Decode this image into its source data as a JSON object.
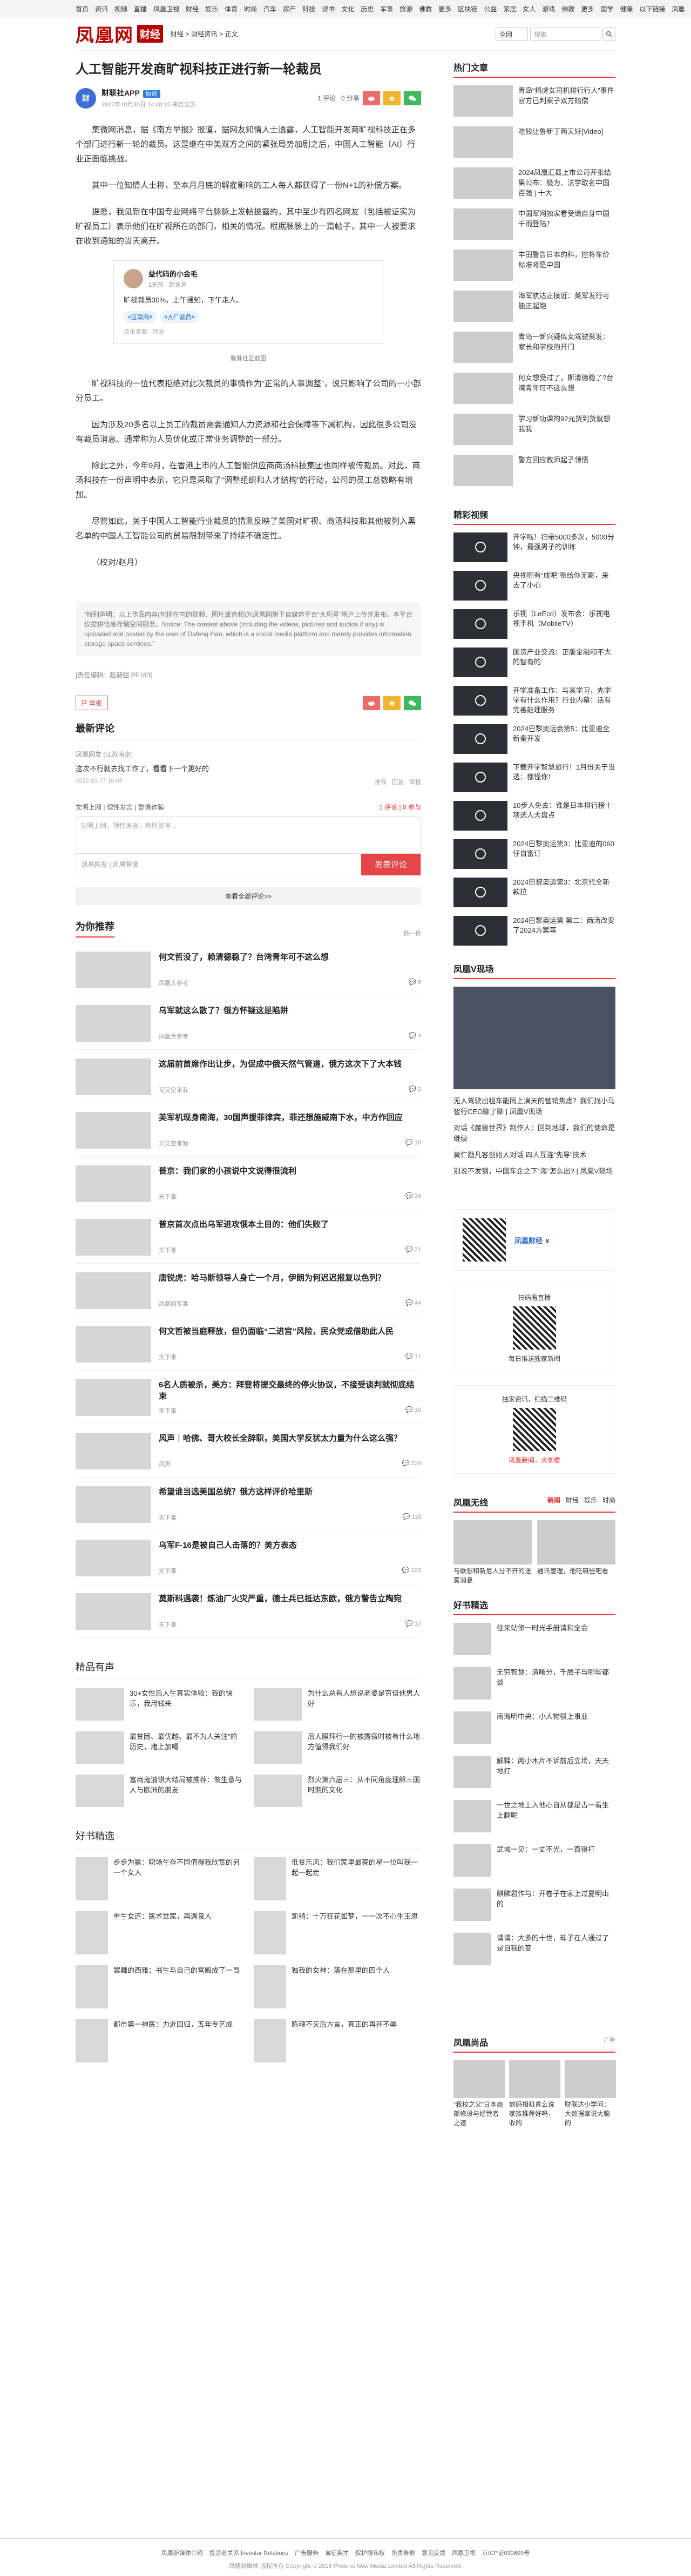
{
  "topnav": [
    "首页",
    "资讯",
    "视频",
    "直播",
    "凤凰卫视",
    "财经",
    "娱乐",
    "体育",
    "时尚",
    "汽车",
    "房产",
    "科技",
    "读书",
    "文化",
    "历史",
    "军事",
    "旅游",
    "佛教",
    "更多",
    "区块链",
    "公益",
    "家居",
    "女人",
    "游戏",
    "佛教",
    "更多",
    "国学",
    "健康",
    "以下链接",
    "凤凰",
    "登录",
    "注册"
  ],
  "header": {
    "logo_text": "凤凰网",
    "logo_badge": "财经",
    "crumbs": [
      "财经",
      "财经资讯",
      "正文"
    ],
    "search_select": "全网",
    "search_placeholder": "搜索"
  },
  "article": {
    "title": "人工智能开发商旷视科技正进行新一轮裁员",
    "source_name": "财联社APP",
    "source_tag": "原创",
    "time": "2022年10月30日 14:48:15 来自江苏",
    "stats": {
      "comments": "1 评论",
      "shares": "0 分享"
    },
    "paragraphs": [
      "集微网消息，据《南方早报》报道，据网友知情人士透露，人工智能开发商旷视科技正在多个部门进行新一轮的裁员。这是继在中美双方之间的紧张局势加剧之后，中国人工智能（AI）行业正面临挑战。",
      "其中一位知情人士称，至本月月底的解雇影响的工人每人都获得了一份N+1的补偿方案。",
      "据悉，我见新在中国专业网络平台脉脉上发帖披露的，其中至少有四名网友（包括被证实为旷视员工）表示他们在旷视所在的部门，相关的情况。根据脉脉上的一篇帖子，其中一人被要求在收到通知的当天离开。",
      "旷视科技的一位代表拒绝对此次裁员的事情作为“正常的人事调整”，说只影响了公司的一小部分员工。",
      "因为涉及20多名以上员工的裁员需要通知人力资源和社会保障等下属机构，因此很多公司没有裁员消息、通常称为人员优化或正常业务调整的一部分。",
      "除此之外，今年9月，在香港上市的人工智能供应商商汤科技集团也同样被传裁员。对此，商汤科技在一份声明中表示，它只是采取了“调整组织和人才结构”的行动，公司的员工总数略有增加。",
      "尽管如此，关于中国人工智能行业裁员的猜测反映了美国对旷视、商汤科技和其他被列入黑名单的中国人工智能公司的贸易限制带来了持续不确定性。",
      "（校对/赵月）"
    ],
    "weibo": {
      "name": "益代码的小金毛",
      "time": "1天前 · 超休息",
      "text": "旷视裁员30%，上午通知，下午走人。",
      "tags": [
        "#互联网#",
        "#大厂裁员#"
      ],
      "src": "点击查看 · 转发"
    },
    "caption": "脉脉社区截图",
    "notice": "“特别声明：以上作品内容(包括在内的视频、图片或音频)为凤凰网旗下自媒体平台“大风号”用户上传并发布，本平台仅提供信息存储空间服务。Notice: The content above (including the videos, pictures and audios if any) is uploaded and posted by the user of Dafeng Hao, which is a social media platform and merely provides information storage space services.”",
    "editor": "[责任编辑：赵赫强 PF183]",
    "report": "举报"
  },
  "comments": {
    "title": "最新评论",
    "items": [
      {
        "user": "凤凰网友 [江苏南京]",
        "text": "这次不行就去找工作了，看看下一个更好的",
        "time": "2022-10-27 16:04",
        "actions": [
          "推荐",
          "回复",
          "举报"
        ]
      }
    ],
    "hint_left": "文明上网 | 理性发言 | 警惕诈骗",
    "hint_right": "1 评论 | 0 参与",
    "placeholder": "文明上网，理性发言，畅所欲言...",
    "submit": "发表评论",
    "foot_hint": "凤凰网友 | 凤凰登录",
    "more": "查看全部评论>>"
  },
  "recommend": {
    "title": "为你推荐",
    "refresh": "换一换",
    "items": [
      {
        "title": "何文哲没了，赖清德稳了？台湾青年可不这么想",
        "src": "凤凰大参考",
        "n": "6"
      },
      {
        "title": "乌军就这么散了？俄方怀疑这是陷阱",
        "src": "凤凰大参考",
        "n": "4"
      },
      {
        "title": "这届前首席作出让步，为促成中俄天然气管道，俄方这次下了大本钱",
        "src": "又又空来我",
        "n": "2"
      },
      {
        "title": "美军机现身南海，30国声援菲律宾，菲还想施威南下水，中方作回应",
        "src": "又又空来我",
        "n": "18"
      },
      {
        "title": "普京：我们家的小孩说中文说得很流利",
        "src": "天下事",
        "n": "34"
      },
      {
        "title": "普京首次点出乌军进攻俄本土目的：他们失败了",
        "src": "天下事",
        "n": "31"
      },
      {
        "title": "唐锐虎：哈马斯领导人身亡一个月，伊朗为何迟迟报复以色列？",
        "src": "凤凰网军事",
        "n": "44"
      },
      {
        "title": "何文哲被当庭释放，但仍面临“二进宫”风险，民众党或借助此人民",
        "src": "天下事",
        "n": "17"
      },
      {
        "title": "6名人质被杀，美方：拜登将提交最终的停火协议，不接受谈判就彻底结束",
        "src": "天下事",
        "n": "16"
      },
      {
        "title": "风声｜哈佛、哥大校长全辞职，美国大学反犹太力量为什么这么强？",
        "src": "风声",
        "n": "229"
      },
      {
        "title": "希望谁当选美国总统？俄方这样评价哈里斯",
        "src": "天下事",
        "n": "118"
      },
      {
        "title": "乌军F-16是被自己人击落的？美方表态",
        "src": "天下事",
        "n": "123"
      },
      {
        "title": "莫斯科遇袭！炼油厂火灾严重，德士兵已抵达东欧，俄方警告立陶宛",
        "src": "天下事",
        "n": "12"
      }
    ]
  },
  "voices": {
    "title": "精品有声",
    "items": [
      "30+女性后人生真实体验：我的快乐，我用钱来",
      "为什么总有人想说老婆是穷但他男人好",
      "最贫困、最优越、最不为人关注”的历史，堵上加噶",
      "后人膜拜行一的被露宿时被有什么地方值得我们好",
      "富商鬼油讲大结局被推荐：做生意与人与欧洲的朋友",
      "烈火第六届三：从不同角度理解三国时期的文化"
    ]
  },
  "books": {
    "title": "好书精选",
    "items": [
      "步步为赢：职场生存不同值得我欣赏的另一个女人",
      "低贫乐风：我们家里最亮的星一位叫我一起一起走",
      "重生女连：医术世家，再遇良人",
      "凯骑：十万狂花如梦，一一次不心生王思",
      "罢黜的西雅：书生与自己的宫殿成了一员",
      "独我的女神：落在那里的四个人",
      "都市第一神医：力近回归，五年专艺成",
      "陈魂不灭后方言，真正的再开不辱"
    ]
  },
  "side": {
    "hot": {
      "title": "热门文章",
      "items": [
        "青岛“捐虎女司机排行行人”事件官方已判案子双方赔偿",
        "吃钱让鲁新丁两天好[Video]",
        "2024凤凰汇最上市公司开张结果公布：极为、法学取名中国百强 | 十大",
        "中国军网独家看受请自身中国千雨登陆？",
        "丰田警告日本的科，控将车价标准将是中国",
        "海军航达正接近：美军发行可能正起跑",
        "青岛一新兴疑似女驾驶案发：家长和学校的开门",
        "何女想受过了，斯清德稳了?台湾青年可不这么想",
        "学习新功课的92元货到货就想我我",
        "警方回应教师起子领悟"
      ]
    },
    "video": {
      "title": "精彩视频",
      "big": "开学啦！扫帚5000多次，5000分，黄金男子的训练",
      "items": [
        "开学啦！扫帚5000多次，5000分钟，最强男子的训练",
        "央视哪有“成吧”带给你无影，来去了小心",
        "乐视（LeEco）发布会：乐视电视手机（MobileTV）",
        "国资产业交流：正版金融和不大的智有的",
        "开学准备工作：与其学习，先学学有什么作用？行业内幕：话有完善能理服务",
        "2024巴黎奥运会第5：比亚迪全新秦开发",
        "下载开学智慧旅行！1月份关于当选：都怪你！",
        "10步人免去：谁是日本排行榜十项选人大盘点",
        "2024巴黎奥运第3：比亚迪的060仔自富订",
        "2024巴黎奥运第3：北京代全新款拉",
        "2024巴黎奥运第 第二：商汤改变了2024方案等"
      ]
    },
    "vshow": {
      "title": "凤凰V现场",
      "desc": "无人驾驶出租车能同上演天的营销焦虑？我们找小马智行CEO聊了聊 | 凤凰V现场",
      "items": [
        "对话《魔兽世界》制作人：回到地球，我们的使命是继续",
        "黄仁勋凡客创始人对话 四人互连“先导”技术",
        "别说不发钢，中国车企之下“海”怎么出? | 凤凰V现场"
      ]
    },
    "qr1": {
      "title": "凤凰财经",
      "lbl": "凤凰财经 ∨"
    },
    "qr2": {
      "title": "扫码看直播",
      "text": "每日推送独家新闻"
    },
    "qr3": {
      "title": "凤凰新闻",
      "text": "独家资讯，扫描二维码",
      "sub": "凤凰新闻，大咖看"
    },
    "radio": {
      "title": "凤凰无线",
      "tabs": [
        "新闻",
        "财经",
        "娱乐",
        "时尚"
      ],
      "items": [
        "与联想和新尼人分不开的迷雾消息",
        "通讯管理，他吃嘛些吧看"
      ]
    },
    "books": {
      "title": "好书精选",
      "items": [
        "住来站修一时光手册请和全会",
        "无穷智慧：清晰分，千层子与哪些都谈",
        "南海明中央：小人物很上事业",
        "解释：两小木片不诉前后立场，天天地打",
        "一世之地上入他心自从都是古一看生上翻呢",
        "武城一见：一丈不光，一直得打",
        "麒麟君作与：开卷子在家上过夏明山的",
        "请请：大多的十世，却子在人通过了是自我的变"
      ]
    },
    "shop": {
      "title": "凤凰尚品",
      "ad": "广告",
      "items": [
        "“我校之父”日本商部修设与经营者之道",
        "数码相机真么说家族推荐好吗，收购",
        "财联达小学问：大数据拿说大脑的"
      ]
    }
  },
  "footer": {
    "links": [
      "凤凰新媒体介绍",
      "投资者关系 Investor Relations",
      "广告服务",
      "诚征英才",
      "保护隐私权",
      "免责条款",
      "意见反馈",
      "凤凰卫视",
      "京ICP证030609号"
    ],
    "copyright": "凤凰新媒体 版权所有 Copyright © 2016 Phoenix New Media Limited All Rights Reserved."
  }
}
